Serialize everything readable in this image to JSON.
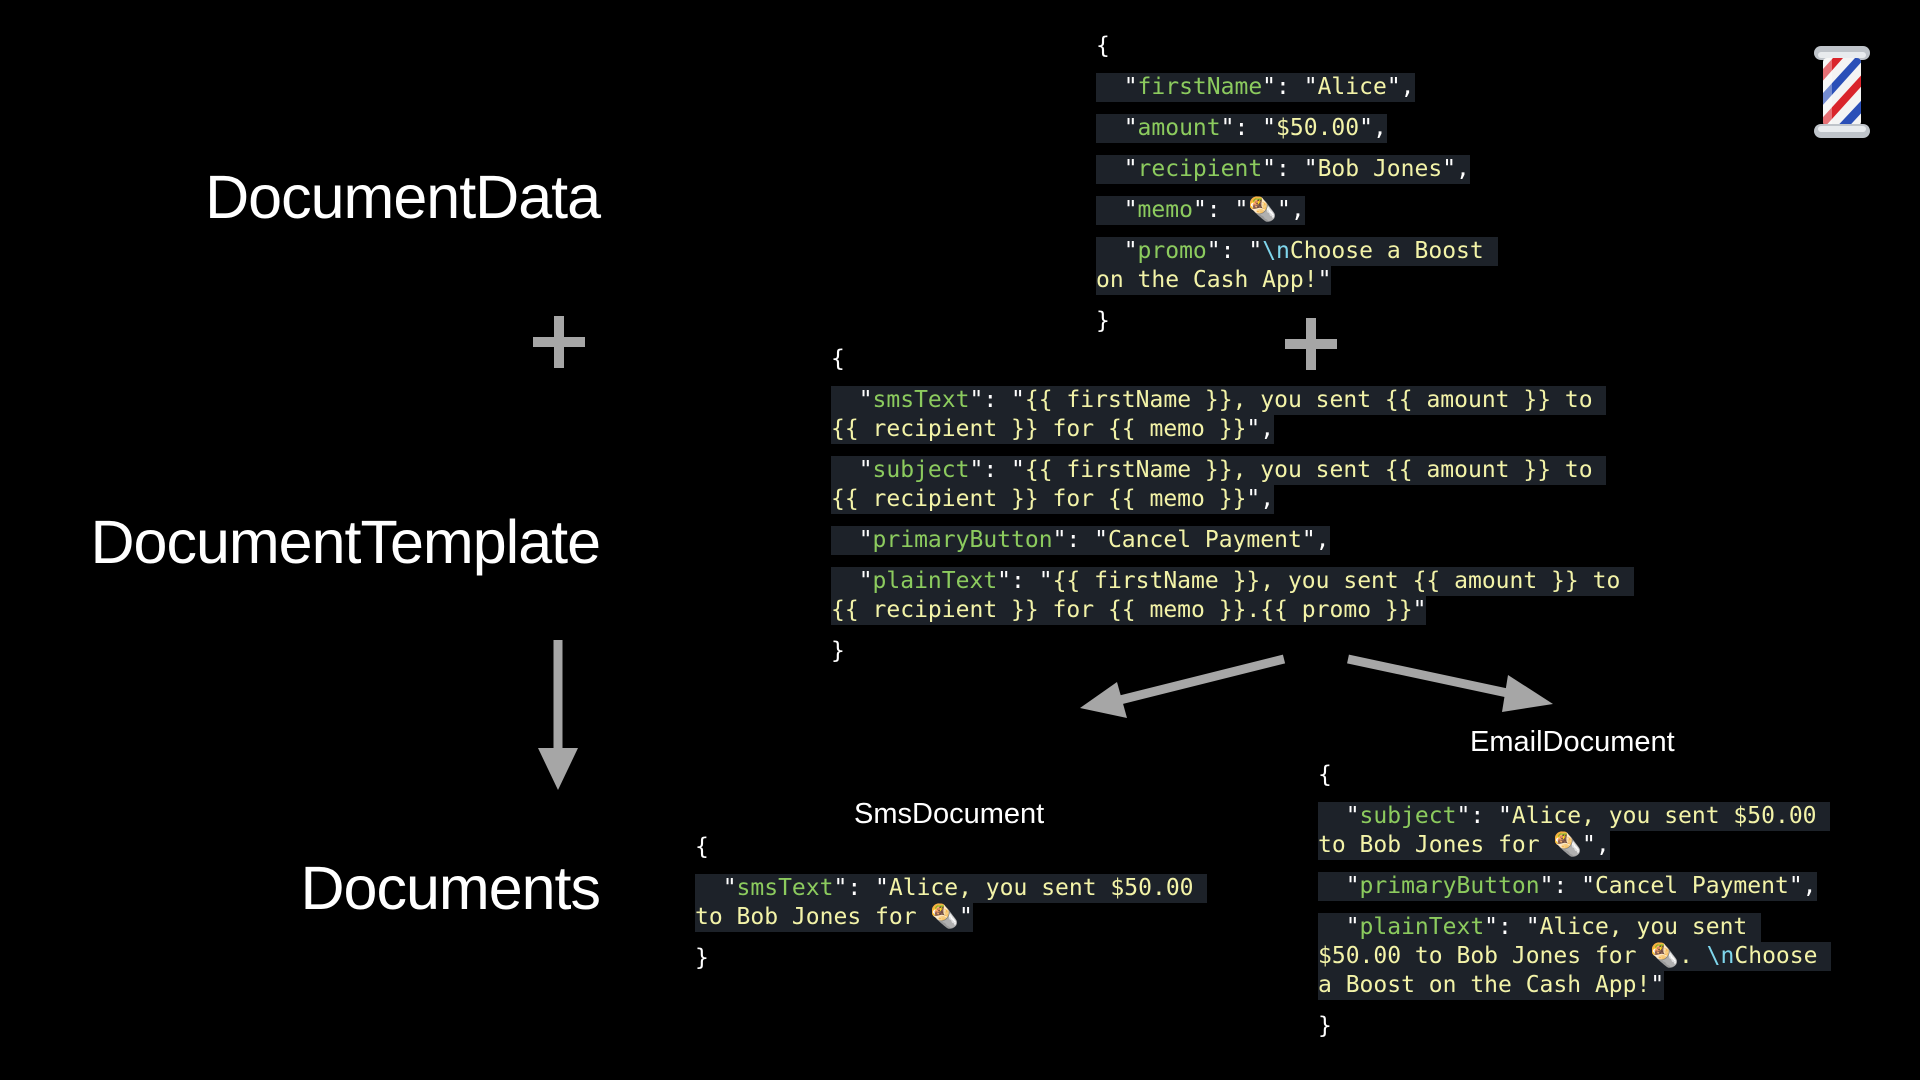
{
  "labels": {
    "document_data": "DocumentData",
    "document_template": "DocumentTemplate",
    "documents": "Documents",
    "sms_document": "SmsDocument",
    "email_document": "EmailDocument"
  },
  "operators": {
    "plus": "+"
  },
  "icons": {
    "corner": "barber-pole-icon",
    "memo_emoji": "burrito-icon"
  },
  "colors": {
    "key": "#8ccb5e",
    "string": "#f3f3a8",
    "escape": "#7fd6ec",
    "highlight": "#1d2229",
    "arrow": "#a6a6a6"
  },
  "data_json": {
    "open": "{",
    "close": "}",
    "firstName": {
      "key": "firstName",
      "value": "Alice"
    },
    "amount": {
      "key": "amount",
      "value": "$50.00"
    },
    "recipient": {
      "key": "recipient",
      "value": "Bob Jones"
    },
    "memo": {
      "key": "memo",
      "value": "🌯"
    },
    "promo": {
      "key": "promo",
      "escape": "\\n",
      "value_1": "Choose a Boost ",
      "value_2": "on the Cash App!"
    }
  },
  "template_json": {
    "open": "{",
    "close": "}",
    "smsText": {
      "key": "smsText",
      "value_1": "{{ firstName }}, you sent {{ amount }} to ",
      "value_2": "{{ recipient }} for {{ memo }}"
    },
    "subject": {
      "key": "subject",
      "value_1": "{{ firstName }}, you sent {{ amount }} to ",
      "value_2": "{{ recipient }} for {{ memo }}"
    },
    "primaryButton": {
      "key": "primaryButton",
      "value": "Cancel Payment"
    },
    "plainText": {
      "key": "plainText",
      "value_1": "{{ firstName }}, you sent {{ amount }} to ",
      "value_2": "{{ recipient }} for {{ memo }}.{{ promo }}"
    }
  },
  "sms_json": {
    "open": "{",
    "close": "}",
    "smsText": {
      "key": "smsText",
      "value_1": "Alice, you sent $50.00 ",
      "value_2": "to Bob Jones for 🌯"
    }
  },
  "email_json": {
    "open": "{",
    "close": "}",
    "subject": {
      "key": "subject",
      "value_1": "Alice, you sent $50.00 ",
      "value_2": "to Bob Jones for 🌯"
    },
    "primaryButton": {
      "key": "primaryButton",
      "value": "Cancel Payment"
    },
    "plainText": {
      "key": "plainText",
      "value_1": "Alice, you sent ",
      "value_2": "$50.00 to Bob Jones for 🌯. ",
      "escape": "\\n",
      "value_3": "Choose ",
      "value_4": "a Boost on the Cash App!"
    }
  }
}
